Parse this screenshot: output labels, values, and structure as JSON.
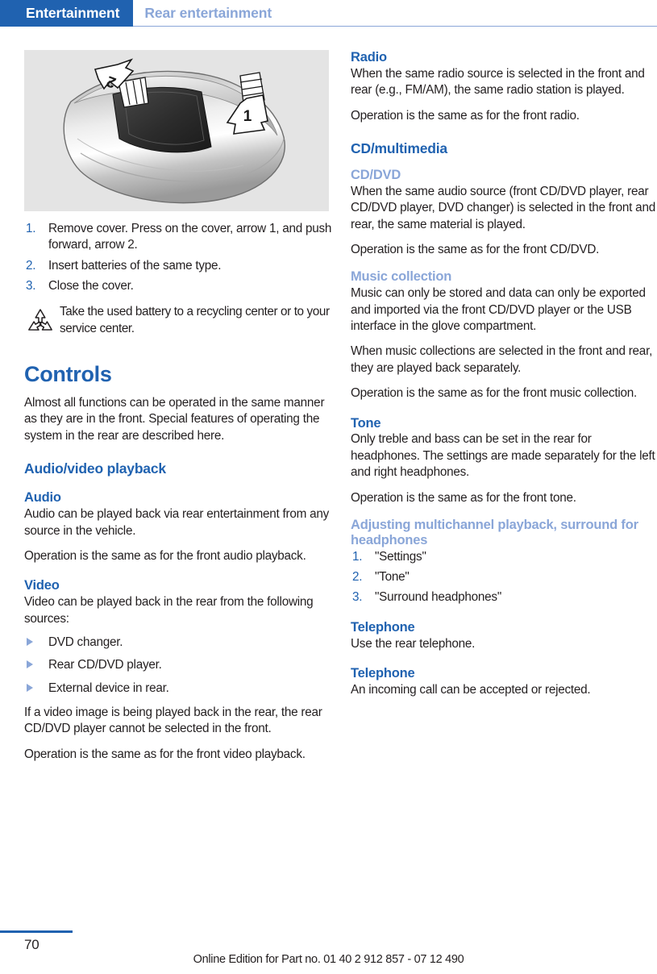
{
  "header": {
    "active_tab": "Entertainment",
    "section_tab": "Rear entertainment",
    "active_bg": "#2062b0",
    "inactive_color": "#8aa6d8"
  },
  "figure": {
    "name": "remote-control-battery-cover",
    "callout_1": "1",
    "callout_2": "2",
    "background": "#e4e4e4"
  },
  "left_column": {
    "battery_steps": [
      "Remove cover. Press on the cover, arrow 1, and push forward, arrow 2.",
      "Insert batteries of the same type.",
      "Close the cover."
    ],
    "recycle_note": "Take the used battery to a recycling center or to your service center.",
    "controls_heading": "Controls",
    "controls_intro": "Almost all functions can be operated in the same manner as they are in the front. Special features of operating the system in the rear are described here.",
    "av_heading": "Audio/video playback",
    "audio_heading": "Audio",
    "audio_p1": "Audio can be played back via rear entertainment from any source in the vehicle.",
    "audio_p2": "Operation is the same as for the front audio playback.",
    "video_heading": "Video",
    "video_intro": "Video can be played back in the rear from the following sources:",
    "video_sources": [
      "DVD changer.",
      "Rear CD/DVD player.",
      "External device in rear."
    ],
    "video_p1": "If a video image is being played back in the rear, the rear CD/DVD player cannot be selected in the front.",
    "video_p2": "Operation is the same as for the front video playback."
  },
  "right_column": {
    "radio_heading": "Radio",
    "radio_p1": "When the same radio source is selected in the front and rear (e.g., FM/AM), the same radio station is played.",
    "radio_p2": "Operation is the same as for the front radio.",
    "cd_multimedia_heading": "CD/multimedia",
    "cd_dvd_heading": "CD/DVD",
    "cd_dvd_p1": "When the same audio source (front CD/DVD player, rear CD/DVD player, DVD changer) is selected in the front and rear, the same material is played.",
    "cd_dvd_p2": "Operation is the same as for the front CD/DVD.",
    "music_collection_heading": "Music collection",
    "music_p1": "Music can only be stored and data can only be exported and imported via the front CD/DVD player or the USB interface in the glove compartment.",
    "music_p2": "When music collections are selected in the front and rear, they are played back separately.",
    "music_p3": "Operation is the same as for the front music collection.",
    "tone_heading": "Tone",
    "tone_p1": "Only treble and bass can be set in the rear for headphones. The settings are made separately for the left and right headphones.",
    "tone_p2": "Operation is the same as for the front tone.",
    "surround_heading": "Adjusting multichannel playback, surround for headphones",
    "surround_steps": [
      "\"Settings\"",
      "\"Tone\"",
      "\"Surround headphones\""
    ],
    "telephone_heading_1": "Telephone",
    "telephone_p1": "Use the rear telephone.",
    "telephone_heading_2": "Telephone",
    "telephone_p2": "An incoming call can be accepted or rejected."
  },
  "footer": {
    "page_number": "70",
    "edition": "Online Edition for Part no. 01 40 2 912 857 - 07 12 490",
    "rule_color": "#2062b0"
  }
}
